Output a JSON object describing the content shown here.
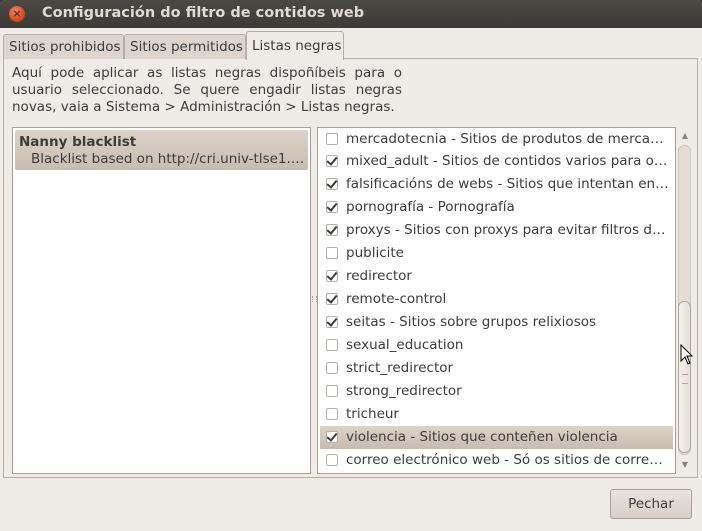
{
  "window": {
    "title": "Configuración do filtro de contidos web"
  },
  "tabs": [
    {
      "label": "Sitios prohibidos",
      "active": false
    },
    {
      "label": "Sitios permitidos",
      "active": false
    },
    {
      "label": "Listas negras",
      "active": true
    }
  ],
  "info_text": "Aquí pode aplicar as listas negras dispoñíbeis para o usuario seleccionado. Se quere engadir listas negras novas, vaia a Sistema > Administración > Listas negras.",
  "blacklists": [
    {
      "name": "Nanny blacklist",
      "description": "Blacklist based on http://cri.univ-tlse1.fr..."
    }
  ],
  "categories": [
    {
      "label": "mercadotecnia - Sitios de produtos de mercado...",
      "checked": false,
      "selected": false
    },
    {
      "label": "mixed_adult - Sitios de contidos varios para o p...",
      "checked": true,
      "selected": false
    },
    {
      "label": "falsificacións de webs - Sitios que intentan eng...",
      "checked": true,
      "selected": false
    },
    {
      "label": "pornografía - Pornografía",
      "checked": true,
      "selected": false
    },
    {
      "label": "proxys - Sitios con proxys para evitar filtros de ...",
      "checked": true,
      "selected": false
    },
    {
      "label": "publicite",
      "checked": false,
      "selected": false
    },
    {
      "label": "redirector",
      "checked": true,
      "selected": false
    },
    {
      "label": "remote-control",
      "checked": true,
      "selected": false
    },
    {
      "label": "seitas - Sitios sobre grupos relixiosos",
      "checked": true,
      "selected": false
    },
    {
      "label": "sexual_education",
      "checked": false,
      "selected": false
    },
    {
      "label": "strict_redirector",
      "checked": false,
      "selected": false
    },
    {
      "label": "strong_redirector",
      "checked": false,
      "selected": false
    },
    {
      "label": "tricheur",
      "checked": false,
      "selected": false
    },
    {
      "label": "violencia - Sitios que conteñen violencia",
      "checked": true,
      "selected": true
    },
    {
      "label": "correo electrónico web - Só os sitios de correo ...",
      "checked": false,
      "selected": false
    }
  ],
  "buttons": {
    "close_label": "Pechar"
  },
  "icons": {
    "close": "close-icon",
    "checkbox": "checkbox-icon",
    "scroll_up": "scroll-up-arrow-icon",
    "scroll_down": "scroll-down-arrow-icon",
    "cursor": "mouse-pointer-icon"
  }
}
